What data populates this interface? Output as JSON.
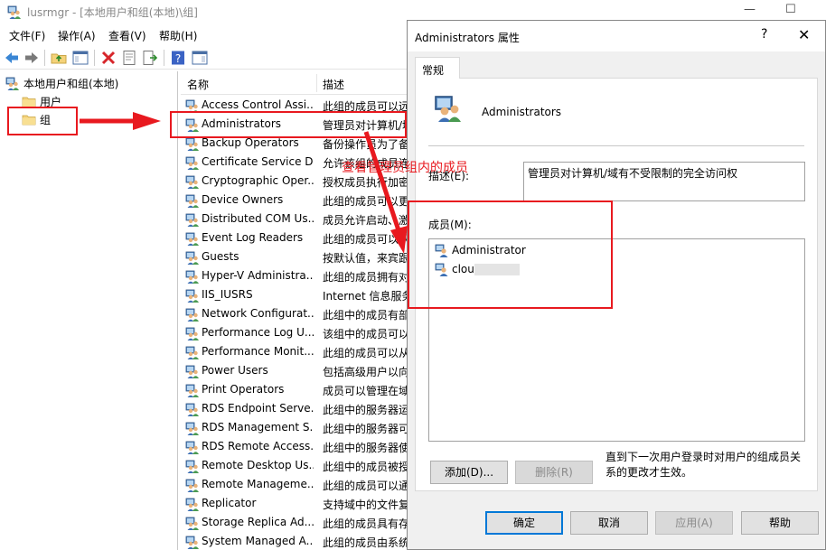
{
  "window": {
    "title": "lusrmgr - [本地用户和组(本地)\\组]",
    "minimize": "—",
    "maximize": "☐"
  },
  "menu": {
    "file": "文件(F)",
    "action": "操作(A)",
    "view": "查看(V)",
    "help": "帮助(H)"
  },
  "tree": {
    "root": "本地用户和组(本地)",
    "users": "用户",
    "groups": "组"
  },
  "list": {
    "col_name": "名称",
    "col_desc": "描述",
    "rows": [
      {
        "name": "Access Control Assi...",
        "desc": "此组的成员可以远"
      },
      {
        "name": "Administrators",
        "desc": "管理员对计算机/域"
      },
      {
        "name": "Backup Operators",
        "desc": "备份操作员为了备"
      },
      {
        "name": "Certificate Service D...",
        "desc": "允许该组的成员连"
      },
      {
        "name": "Cryptographic Oper...",
        "desc": "授权成员执行加密"
      },
      {
        "name": "Device Owners",
        "desc": "此组的成员可以更"
      },
      {
        "name": "Distributed COM Us...",
        "desc": "成员允许启动、激"
      },
      {
        "name": "Event Log Readers",
        "desc": "此组的成员可以从"
      },
      {
        "name": "Guests",
        "desc": "按默认值，来宾跟"
      },
      {
        "name": "Hyper-V Administra...",
        "desc": "此组的成员拥有对"
      },
      {
        "name": "IIS_IUSRS",
        "desc": "Internet 信息服务"
      },
      {
        "name": "Network Configurat...",
        "desc": "此组中的成员有部"
      },
      {
        "name": "Performance Log U...",
        "desc": "该组中的成员可以"
      },
      {
        "name": "Performance Monit...",
        "desc": "此组的成员可以从"
      },
      {
        "name": "Power Users",
        "desc": "包括高级用户以向"
      },
      {
        "name": "Print Operators",
        "desc": "成员可以管理在域"
      },
      {
        "name": "RDS Endpoint Serve...",
        "desc": "此组中的服务器运"
      },
      {
        "name": "RDS Management S...",
        "desc": "此组中的服务器可"
      },
      {
        "name": "RDS Remote Access...",
        "desc": "此组中的服务器使"
      },
      {
        "name": "Remote Desktop Us...",
        "desc": "此组中的成员被授"
      },
      {
        "name": "Remote Manageme...",
        "desc": "此组的成员可以通"
      },
      {
        "name": "Replicator",
        "desc": "支持域中的文件复"
      },
      {
        "name": "Storage Replica Ad...",
        "desc": "此组的成员具有存"
      },
      {
        "name": "System Managed A...",
        "desc": "此组的成员由系统"
      }
    ]
  },
  "dialog": {
    "title": "Administrators 属性",
    "help_glyph": "?",
    "close_glyph": "✕",
    "tab_general": "常规",
    "group_name": "Administrators",
    "desc_label": "描述(E):",
    "desc_value": "管理员对计算机/域有不受限制的完全访问权",
    "members_label": "成员(M):",
    "members": [
      "Administrator",
      "clou"
    ],
    "note": "直到下一次用户登录时对用户的组成员关系的更改才生效。",
    "btn_add": "添加(D)...",
    "btn_remove": "删除(R)",
    "btn_ok": "确定",
    "btn_cancel": "取消",
    "btn_apply": "应用(A)",
    "btn_help": "帮助"
  },
  "annotation": {
    "text": "查看管理员组内的成员",
    "color": "#e8191f"
  }
}
